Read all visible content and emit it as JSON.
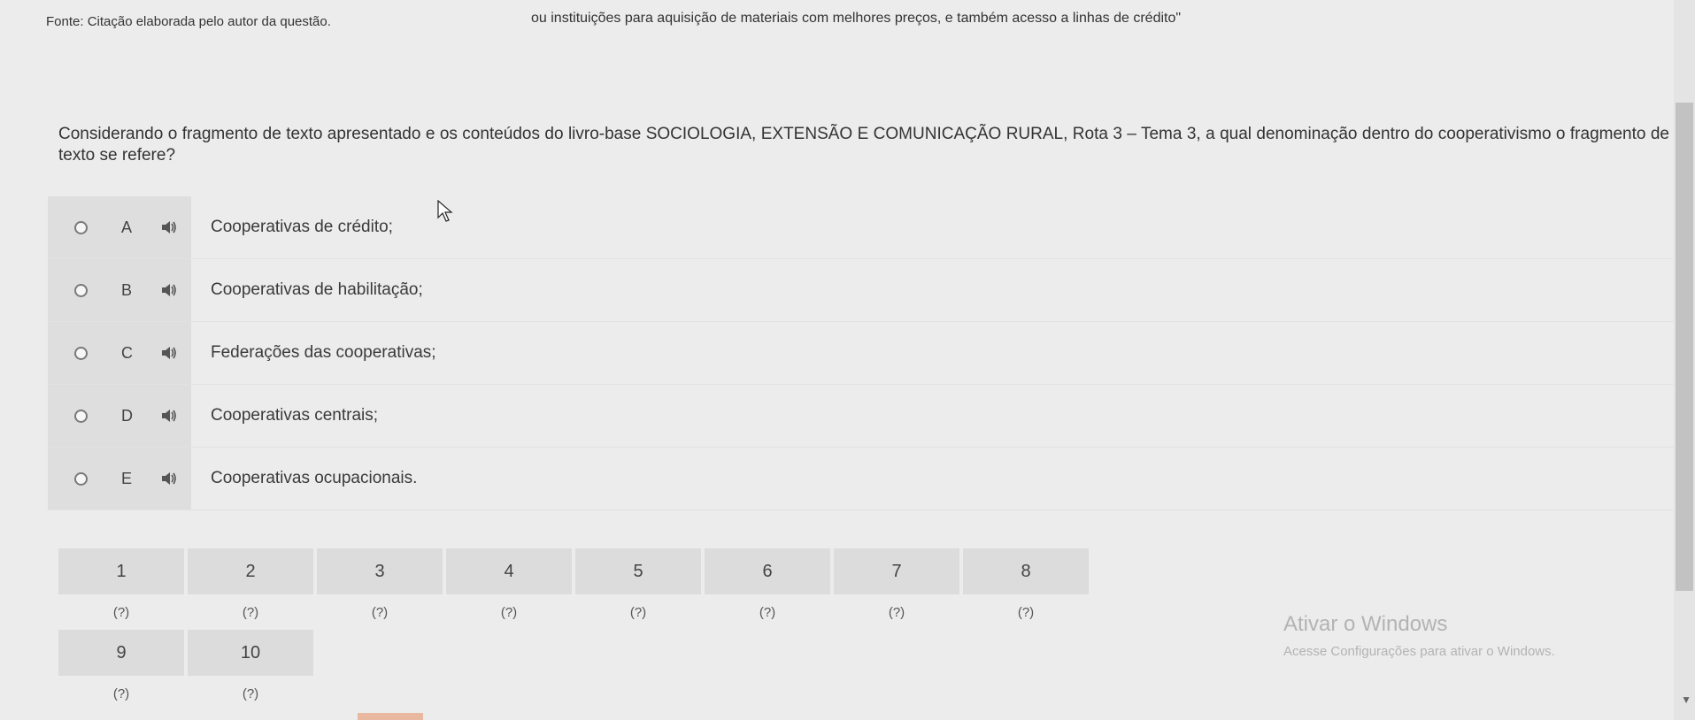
{
  "header": {
    "top_fragment": "ou instituições para aquisição de materiais com melhores preços, e também acesso a linhas de crédito\"",
    "source": "Fonte: Citação elaborada pelo autor da questão."
  },
  "question": {
    "text": "Considerando o fragmento de texto apresentado e os conteúdos do livro-base SOCIOLOGIA, EXTENSÃO E COMUNICAÇÃO RURAL, Rota 3 – Tema 3, a qual denominação dentro do cooperativismo o fragmento de texto se refere?"
  },
  "options": [
    {
      "letter": "A",
      "text": "Cooperativas de crédito;"
    },
    {
      "letter": "B",
      "text": "Cooperativas de habilitação;"
    },
    {
      "letter": "C",
      "text": "Federações das cooperativas;"
    },
    {
      "letter": "D",
      "text": "Cooperativas centrais;"
    },
    {
      "letter": "E",
      "text": "Cooperativas ocupacionais."
    }
  ],
  "navigation": {
    "numbers": [
      "1",
      "2",
      "3",
      "4",
      "5",
      "6",
      "7",
      "8",
      "9",
      "10"
    ],
    "statuses": [
      "(?)",
      "(?)",
      "(?)",
      "(?)",
      "(?)",
      "(?)",
      "(?)",
      "(?)",
      "(?)",
      "(?)"
    ]
  },
  "watermark": {
    "title": "Ativar o Windows",
    "subtitle": "Acesse Configurações para ativar o Windows."
  },
  "icons": {
    "speaker": "speaker-icon",
    "cursor": "mouse-pointer-icon"
  }
}
